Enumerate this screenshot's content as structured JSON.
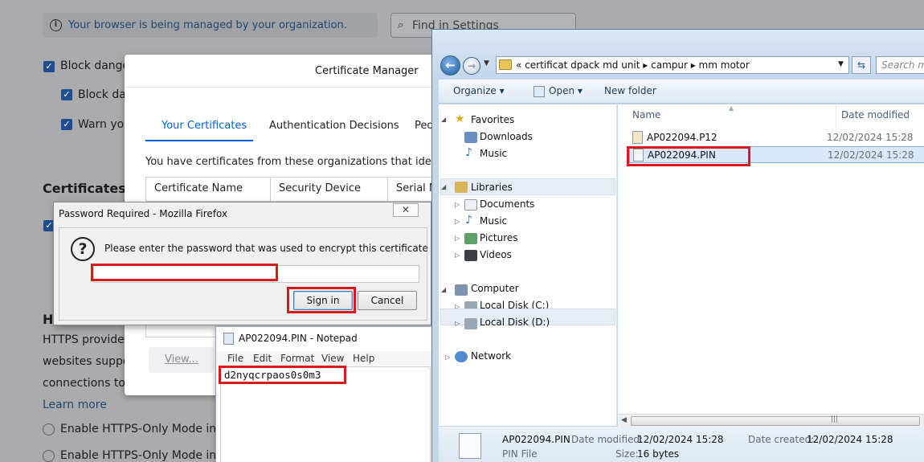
{
  "settings": {
    "managed_notice": "Your browser is being managed by your organization.",
    "find_placeholder": "Find in Settings",
    "block_dangerous": "Block dange",
    "block_dangerous_2": "Block dan",
    "warn_you": "Warn you",
    "certificates_heading": "Certificates",
    "https_heading": "H",
    "https_desc_1": "HTTPS provides",
    "https_desc_2": "websites suppo",
    "https_desc_3": "connections to",
    "learn_more": "Learn more",
    "https_only_all": "Enable HTTPS-Only Mode in",
    "https_only_private": "Enable HTTPS-Only Mode in"
  },
  "cert_manager": {
    "title": "Certificate Manager",
    "tabs": [
      "Your Certificates",
      "Authentication Decisions",
      "Peo"
    ],
    "description": "You have certificates from these organizations that identify yo",
    "columns": [
      "Certificate Name",
      "Security Device",
      "Serial N"
    ],
    "view_button": "View..."
  },
  "password_dialog": {
    "title": "Password Required - Mozilla Firefox",
    "message": "Please enter the password that was used to encrypt this certificate backup:",
    "password_value": "",
    "sign_in_button": "Sign in",
    "cancel_button": "Cancel",
    "close_glyph": "✕"
  },
  "notepad": {
    "title": "AP022094.PIN - Notepad",
    "menu": [
      "File",
      "Edit",
      "Format",
      "View",
      "Help"
    ],
    "content": "d2nyqcrpaos0s0m3"
  },
  "explorer": {
    "breadcrumb": "«  certificat  dpack md unit  ▸  campur  ▸  mm motor",
    "search_placeholder": "Search mm",
    "toolbar": {
      "organize": "Organize  ▾",
      "open": "Open  ▾",
      "new_folder": "New folder"
    },
    "nav": {
      "favorites": "Favorites",
      "downloads": "Downloads",
      "music_fav": "Music",
      "libraries": "Libraries",
      "documents": "Documents",
      "music": "Music",
      "pictures": "Pictures",
      "videos": "Videos",
      "computer": "Computer",
      "disk_c": "Local Disk (C:)",
      "disk_d": "Local Disk (D:)",
      "network": "Network"
    },
    "columns": {
      "name": "Name",
      "date_modified": "Date modified"
    },
    "files": [
      {
        "name": "AP022094.P12",
        "date": "12/02/2024 15:28"
      },
      {
        "name": "AP022094.PIN",
        "date": "12/02/2024 15:28"
      }
    ],
    "details": {
      "file_name": "AP022094.PIN",
      "file_type": "PIN File",
      "date_modified_label": "Date modified:",
      "date_modified": "12/02/2024 15:28",
      "date_created_label": "Date created:",
      "date_created": "12/02/2024 15:28",
      "size_label": "Size:",
      "size": "16 bytes"
    }
  },
  "colors": {
    "annotation_red": "#d91a1a",
    "firefox_accent": "#0061e0",
    "selection_blue": "#d9e8fa"
  }
}
